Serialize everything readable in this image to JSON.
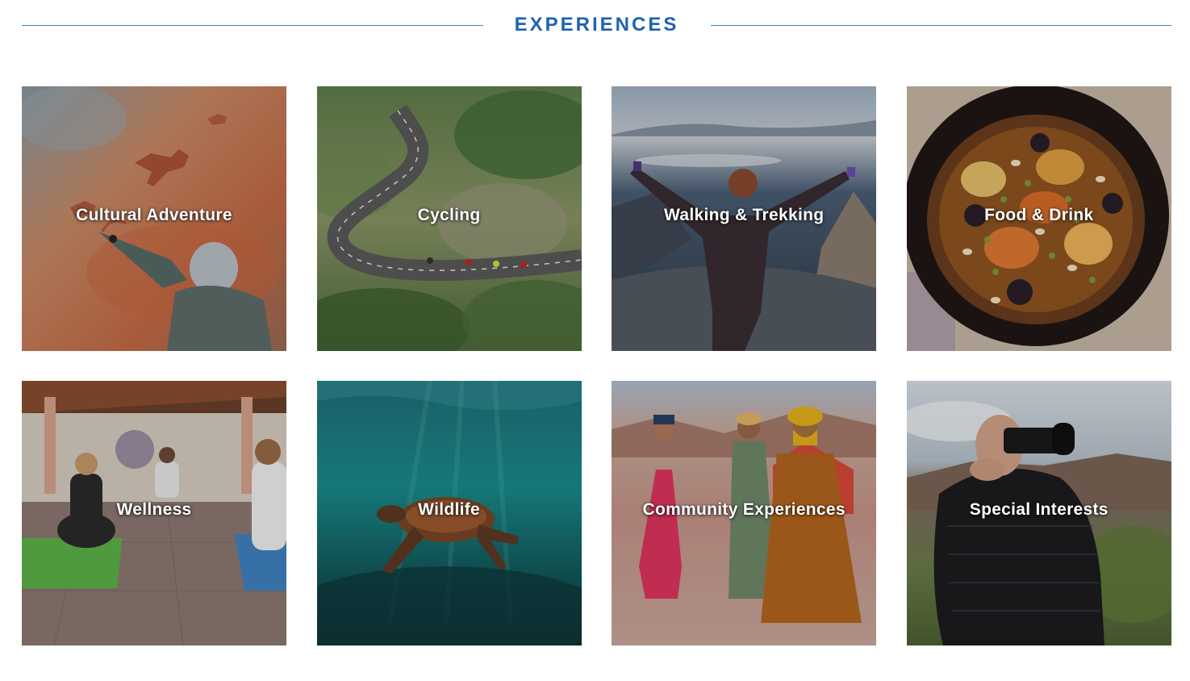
{
  "section": {
    "title": "EXPERIENCES",
    "accent_color": "#1f63ad",
    "rule_color": "#3f86c6"
  },
  "tiles": [
    {
      "label": "Cultural Adventure",
      "icon": "rock-art-photo"
    },
    {
      "label": "Cycling",
      "icon": "winding-road-photo"
    },
    {
      "label": "Walking & Trekking",
      "icon": "mountain-summit-photo"
    },
    {
      "label": "Food & Drink",
      "icon": "tagine-dish-photo"
    },
    {
      "label": "Wellness",
      "icon": "yoga-studio-photo"
    },
    {
      "label": "Wildlife",
      "icon": "sea-turtle-photo"
    },
    {
      "label": "Community Experiences",
      "icon": "desert-musicians-photo"
    },
    {
      "label": "Special Interests",
      "icon": "photographer-photo"
    }
  ]
}
